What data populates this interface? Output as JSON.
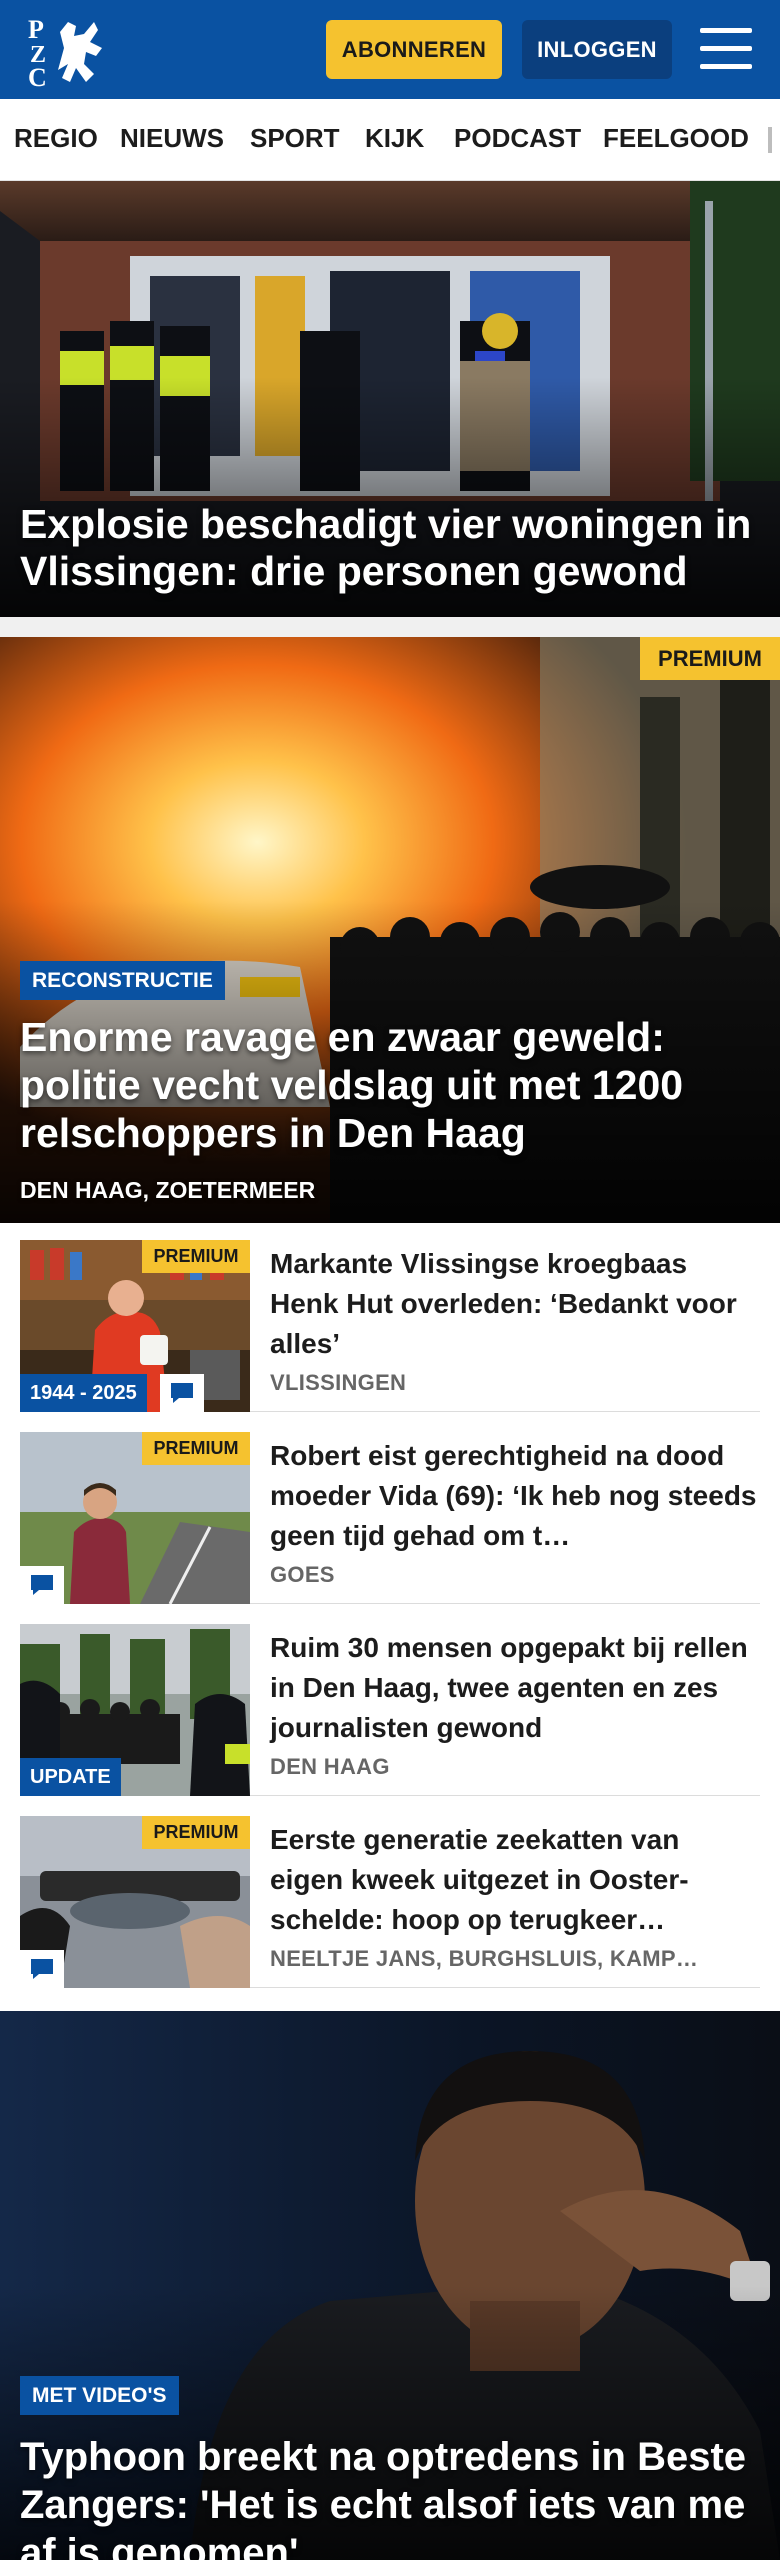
{
  "header": {
    "logo_text": "PZC",
    "subscribe_label": "ABONNEREN",
    "login_label": "INLOGGEN",
    "menu_icon": "hamburger-menu-icon",
    "brand_color": "#0a52a2",
    "accent_color": "#f5c22f"
  },
  "nav": {
    "items": [
      "REGIO",
      "NIEUWS",
      "SPORT",
      "KIJK",
      "PODCAST",
      "FEELGOOD"
    ]
  },
  "hero1": {
    "title": "Explosie beschadigt vier woningen in Vlissingen: drie personen gewond"
  },
  "hero2": {
    "premium": "PREMIUM",
    "label": "RECONSTRUCTIE",
    "title": "Enorme ravage en zwaar geweld: politie vecht veldslag uit met 1200 relschoppers in Den Haag",
    "location": "DEN HAAG, ZOETERMEER"
  },
  "articles": [
    {
      "premium": "PREMIUM",
      "thumb_label": "1944 - 2025",
      "title": "Markante Vlissingse kroegbaas Henk Hut overleden: ‘Bedankt voor alles’",
      "location": "VLISSINGEN"
    },
    {
      "premium": "PREMIUM",
      "title": "Robert eist gerechtigheid na dood moeder Vida (69): ‘Ik heb nog steeds geen tijd gehad om t…",
      "location": "GOES"
    },
    {
      "thumb_label": "UPDATE",
      "title": "Ruim 30 mensen opgepakt bij rellen in Den Haag, twee agenten en zes journalisten gewond",
      "location": "DEN HAAG"
    },
    {
      "premium": "PREMIUM",
      "title": "Eerste generatie zeekatten van eigen kweek uitgezet in Ooster­schelde: hoop op terugkeer…",
      "location": "NEELTJE JANS, BURGHSLUIS, KAMP…"
    }
  ],
  "hero3": {
    "label": "MET VIDEO'S",
    "title": "Typhoon breekt na optredens in Beste Zangers: 'Het is echt alsof iets van me af is genomen'"
  }
}
